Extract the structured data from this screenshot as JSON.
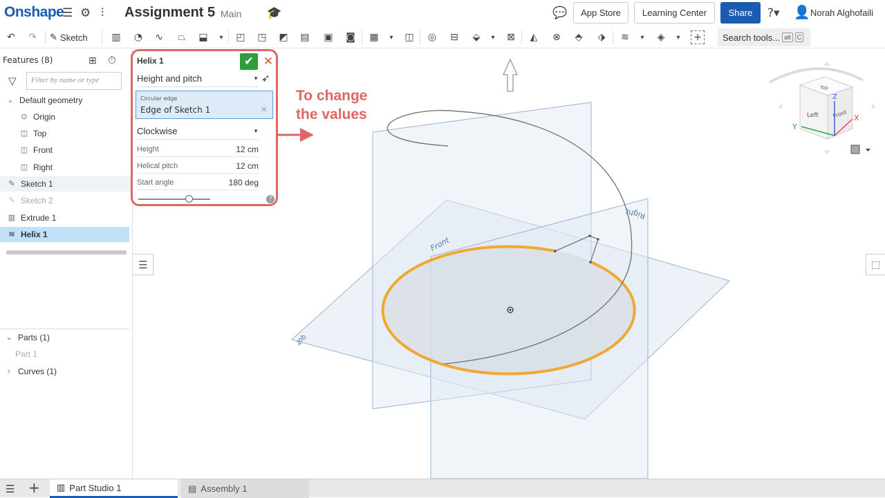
{
  "header": {
    "logo": "Onshape",
    "doc_title": "Assignment 5",
    "branch": "Main",
    "app_store": "App Store",
    "learning_center": "Learning Center",
    "share": "Share",
    "user": "Norah Alghofaili"
  },
  "toolbar": {
    "sketch_label": "Sketch",
    "search_label": "Search tools...",
    "search_key1": "alt",
    "search_key2": "C"
  },
  "features": {
    "header": "Features (8)",
    "filter_placeholder": "Filter by name or type",
    "default_geometry": "Default geometry",
    "items": [
      "Origin",
      "Top",
      "Front",
      "Right",
      "Sketch 1",
      "Sketch 2",
      "Extrude 1",
      "Helix 1"
    ],
    "parts": "Parts (1)",
    "part1": "Part 1",
    "curves": "Curves (1)"
  },
  "dialog": {
    "title": "Helix 1",
    "mode": "Height and pitch",
    "edge_label": "Circular edge",
    "edge_value": "Edge of Sketch 1",
    "direction": "Clockwise",
    "height_label": "Height",
    "height_value": "12 cm",
    "pitch_label": "Helical pitch",
    "pitch_value": "12 cm",
    "angle_label": "Start angle",
    "angle_value": "180 deg",
    "slider_fraction": 0.7
  },
  "annotation": {
    "line1": "To change",
    "line2": "the values",
    "color": "#e06666"
  },
  "viewport": {
    "plane_top": "Top",
    "plane_front": "Front",
    "plane_right": "Right",
    "cube_top": "Top",
    "cube_left": "Left",
    "cube_front": "Front",
    "axis_x": "X",
    "axis_y": "Y",
    "axis_z": "Z"
  },
  "tabs": {
    "part_studio": "Part Studio 1",
    "assembly": "Assembly 1"
  },
  "colors": {
    "brand": "#1b5bb0",
    "confirm": "#2e9e3c",
    "edge_highlight": "#f0a830",
    "selected_row": "#bfe0f7"
  }
}
